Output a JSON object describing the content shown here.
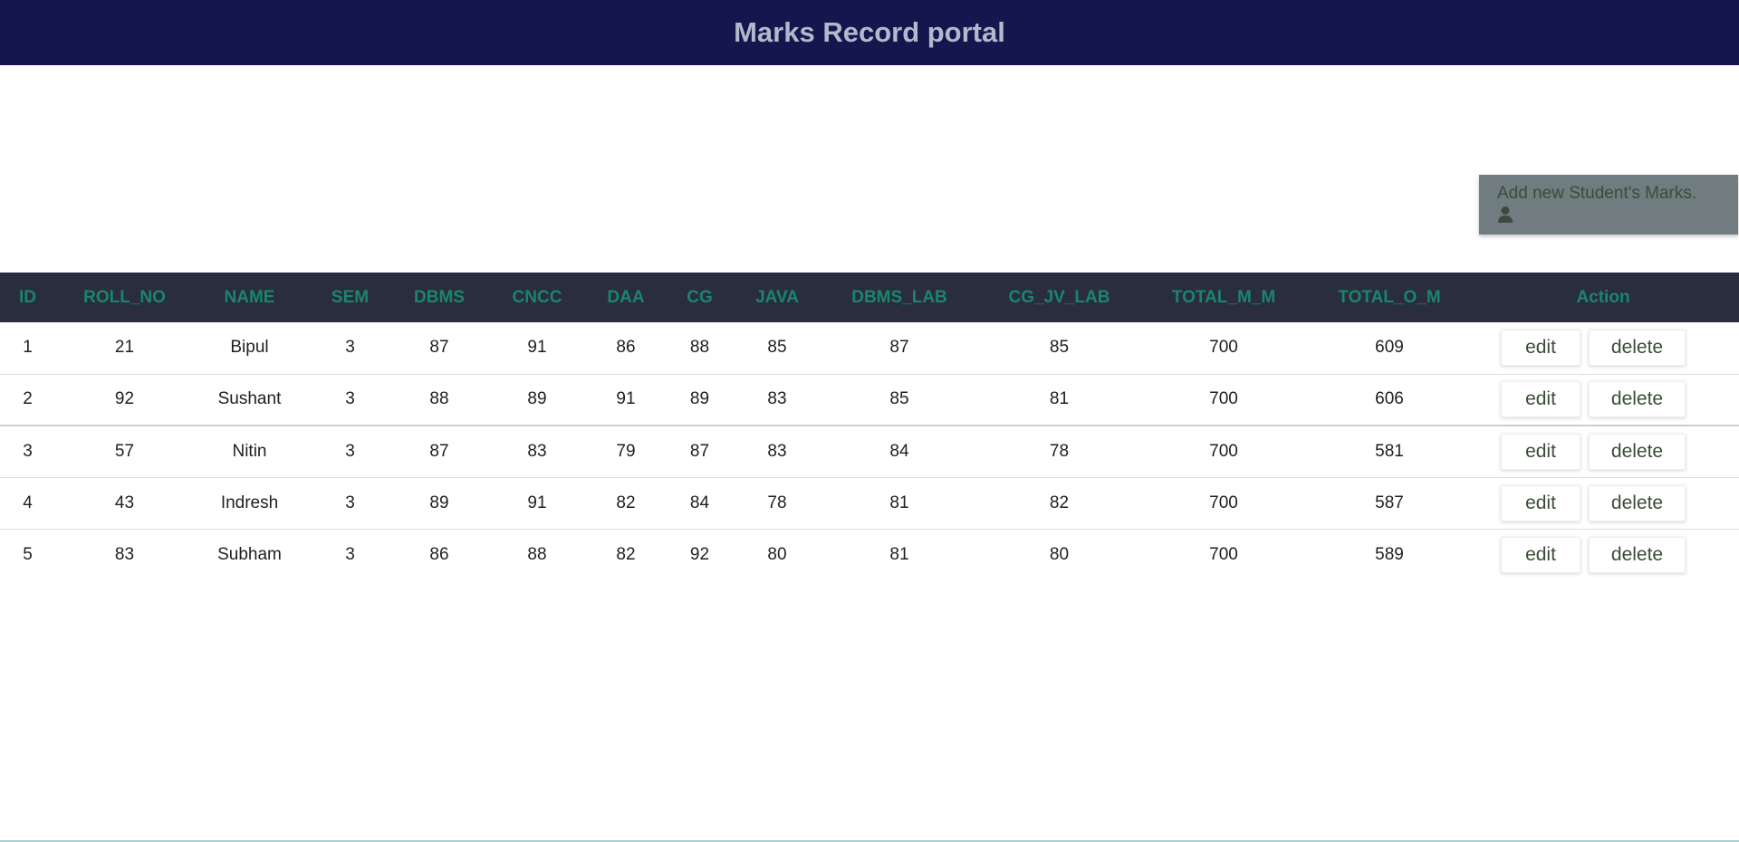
{
  "header": {
    "title": "Marks Record portal",
    "background": "#15164d"
  },
  "add_button": {
    "label": "Add new Student's Marks.",
    "icon": "user-icon"
  },
  "table": {
    "columns": [
      "ID",
      "ROLL_NO",
      "NAME",
      "SEM",
      "DBMS",
      "CNCC",
      "DAA",
      "CG",
      "JAVA",
      "DBMS_LAB",
      "CG_JV_LAB",
      "TOTAL_M_M",
      "TOTAL_O_M",
      "Action"
    ],
    "rows": [
      [
        "1",
        "21",
        "Bipul",
        "3",
        "87",
        "91",
        "86",
        "88",
        "85",
        "87",
        "85",
        "700",
        "609"
      ],
      [
        "2",
        "92",
        "Sushant",
        "3",
        "88",
        "89",
        "91",
        "89",
        "83",
        "85",
        "81",
        "700",
        "606"
      ],
      [
        "3",
        "57",
        "Nitin",
        "3",
        "87",
        "83",
        "79",
        "87",
        "83",
        "84",
        "78",
        "700",
        "581"
      ],
      [
        "4",
        "43",
        "Indresh",
        "3",
        "89",
        "91",
        "82",
        "84",
        "78",
        "81",
        "82",
        "700",
        "587"
      ],
      [
        "5",
        "83",
        "Subham",
        "3",
        "86",
        "88",
        "82",
        "92",
        "80",
        "81",
        "80",
        "700",
        "589"
      ]
    ],
    "edit_label": "edit",
    "delete_label": "delete"
  },
  "colors": {
    "header_text": "#b4b8cc",
    "table_header_bg": "#292d3e",
    "column_header_text": "#19866c",
    "button_text": "#394d36"
  }
}
